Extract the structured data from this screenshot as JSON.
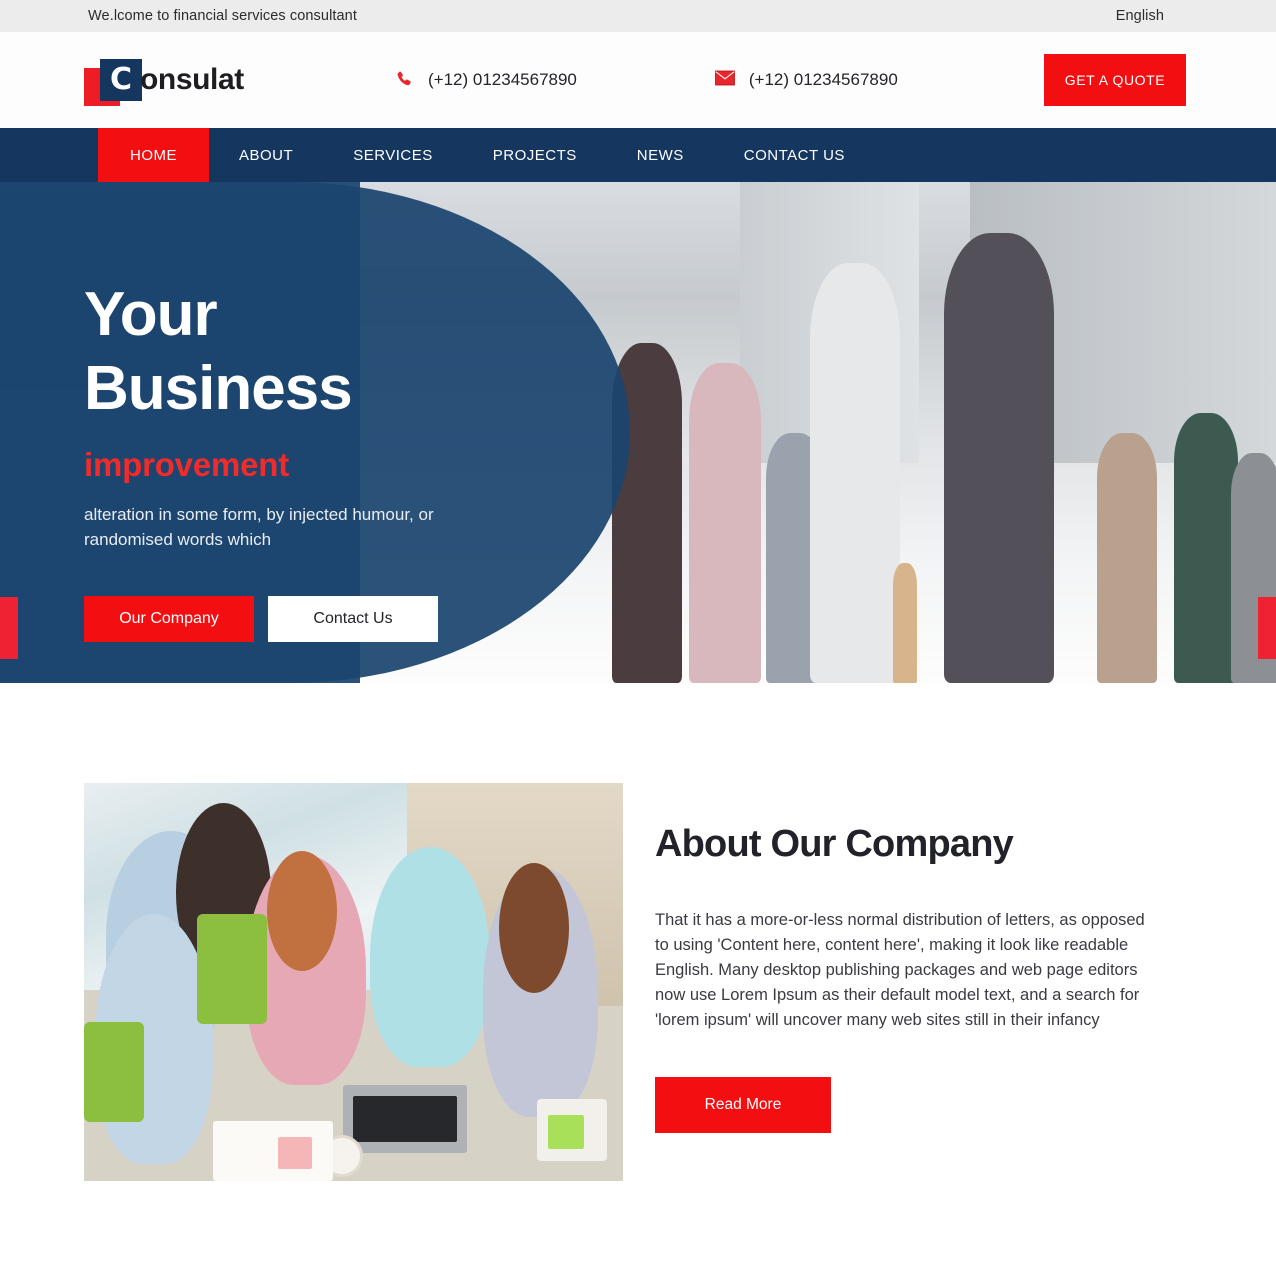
{
  "topbar": {
    "welcome": "We.lcome to financial services consultant",
    "language": "English"
  },
  "header": {
    "logo_mark": "C",
    "logo_word": "onsulat",
    "phone": "(+12) 01234567890",
    "email_phone": "(+12) 01234567890",
    "quote_label": "GET A QUOTE",
    "phone_icon": "phone-icon",
    "mail_icon": "mail-icon"
  },
  "nav": {
    "items": [
      {
        "label": "HOME",
        "active": true
      },
      {
        "label": "ABOUT",
        "active": false
      },
      {
        "label": "SERVICES",
        "active": false
      },
      {
        "label": "PROJECTS",
        "active": false
      },
      {
        "label": "NEWS",
        "active": false
      },
      {
        "label": "CONTACT US",
        "active": false
      }
    ]
  },
  "hero": {
    "title_line1": "Your",
    "title_line2": "Business",
    "accent": "improvement",
    "subtitle": "alteration in some form, by injected humour, or randomised words which",
    "primary_button": "Our Company",
    "secondary_button": "Contact Us",
    "prev_arrow": "slider-prev-arrow",
    "next_arrow": "slider-next-arrow"
  },
  "about": {
    "heading": "About Our Company",
    "body": "That it has a more-or-less normal distribution of letters, as opposed to using 'Content here, content here', making it look like readable English. Many desktop publishing packages and web page editors now use Lorem Ipsum as their default model text, and a search for 'lorem ipsum' will uncover many web sites still in their infancy",
    "read_more": "Read More"
  },
  "colors": {
    "accent_red": "#f30e11",
    "brand_navy": "#15365f",
    "overlay_blue": "#1b456f",
    "topbar_grey": "#ececec"
  }
}
